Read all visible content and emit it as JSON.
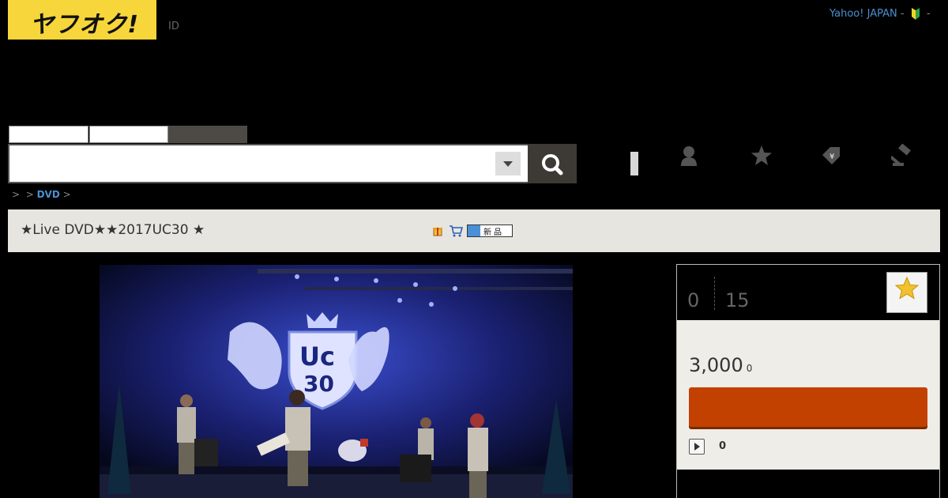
{
  "header": {
    "logo_text": "ヤフオク!",
    "id_label": "ID",
    "yahoo_link": "Yahoo! JAPAN",
    "dash": "-"
  },
  "search": {
    "tabs": [
      "",
      "",
      ""
    ],
    "placeholder": ""
  },
  "nav_icons": [
    "menu-bar-icon",
    "user-icon",
    "star-icon",
    "price-tag-icon",
    "gavel-icon"
  ],
  "breadcrumb": {
    "sep1": ">",
    "sep2": ">",
    "category": "DVD",
    "sep3": ">"
  },
  "item": {
    "title": "★Live DVD★★2017UC30 ★",
    "new_badge": "新品"
  },
  "panel": {
    "count_left": "0",
    "count_right": "15",
    "price": "3,000",
    "price_suffix": "0",
    "bid_count": "0"
  },
  "colors": {
    "logo_yellow": "#f6d63a",
    "bid_button": "#c24100",
    "link_blue": "#4a8fd0",
    "title_bar": "#e7e5e0"
  }
}
